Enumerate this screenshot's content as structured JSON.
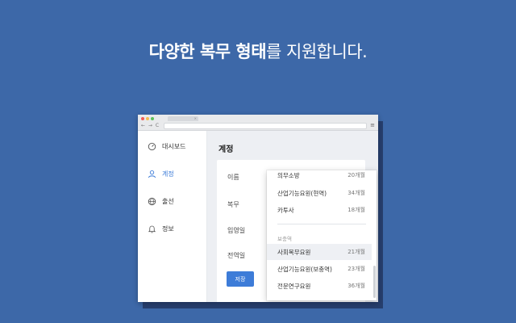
{
  "headline": {
    "bold1": "다양한 복무 형태",
    "rest": "를 지원합니다."
  },
  "browser": {
    "nav_label": "← → C",
    "menu_glyph": "≡",
    "tab_close": "×",
    "dot_colors": [
      "#f05b56",
      "#f4bd4f",
      "#5cc15a"
    ]
  },
  "sidebar": {
    "items": [
      {
        "label": "대시보드",
        "icon": "gauge-icon"
      },
      {
        "label": "계정",
        "icon": "user-icon",
        "active": true
      },
      {
        "label": "출선",
        "icon": "globe-icon"
      },
      {
        "label": "정보",
        "icon": "bell-icon"
      }
    ]
  },
  "main": {
    "title": "계정",
    "fields": [
      "이름",
      "복무",
      "입영일",
      "전역일"
    ],
    "save_label": "저장"
  },
  "dropdown": {
    "rows_top": [
      {
        "label": "의무소방",
        "duration": "20개월"
      },
      {
        "label": "산업기능요원(현역)",
        "duration": "34개월"
      },
      {
        "label": "카투사",
        "duration": "18개월"
      }
    ],
    "group_label": "보충역",
    "rows_bottom": [
      {
        "label": "사회복무요원",
        "duration": "21개월",
        "highlight": true
      },
      {
        "label": "산업기능요원(보충역)",
        "duration": "23개월"
      },
      {
        "label": "전문연구요원",
        "duration": "36개월"
      }
    ]
  },
  "colors": {
    "background": "#3d68a8",
    "accent": "#3d7cd8"
  }
}
